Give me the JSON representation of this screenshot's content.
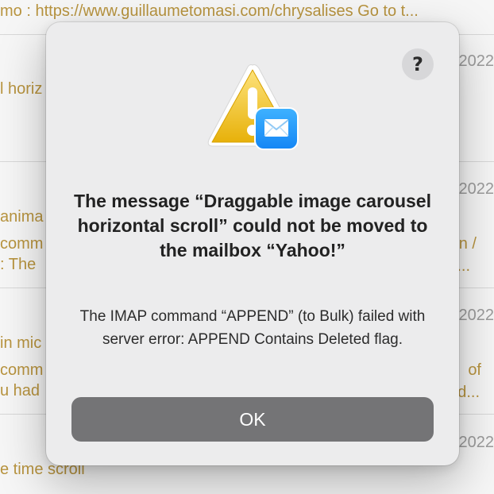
{
  "background_list": {
    "top_line": "mo : https://www.guillaumetomasi.com/chrysalises Go to t...",
    "fragments": [
      "l horiz",
      "anima",
      "comm",
      ": The",
      "in mic",
      "comm",
      "u had",
      "e time scroll"
    ],
    "right_fragments": [
      "n /",
      "...",
      "of",
      "ed..."
    ],
    "dates": [
      "2022",
      "2022",
      "2022",
      "2022"
    ]
  },
  "dialog": {
    "help_label": "?",
    "title": "The message “Draggable image carousel horizontal scroll” could not be moved to the mailbox “Yahoo!”",
    "message": "The IMAP command “APPEND” (to Bulk) failed with server error: APPEND Contains Deleted flag.",
    "ok_label": "OK",
    "icon": "caution-mail-icon"
  }
}
